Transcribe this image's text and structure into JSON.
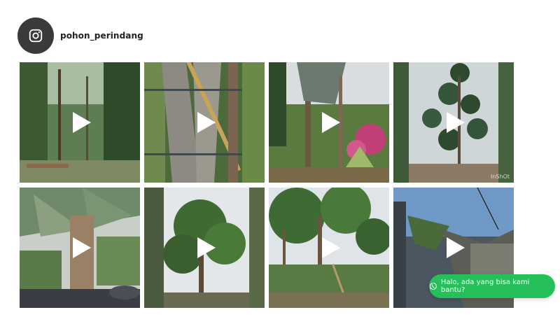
{
  "profile": {
    "username": "pohon_perindang",
    "icon": "instagram-icon"
  },
  "feed": {
    "posts": [
      {
        "type": "video",
        "icon": "play-icon",
        "watermark": ""
      },
      {
        "type": "video",
        "icon": "play-icon",
        "watermark": ""
      },
      {
        "type": "video",
        "icon": "play-icon",
        "watermark": ""
      },
      {
        "type": "video",
        "icon": "play-icon",
        "watermark": "InShOt"
      },
      {
        "type": "video",
        "icon": "play-icon",
        "watermark": ""
      },
      {
        "type": "video",
        "icon": "play-icon",
        "watermark": ""
      },
      {
        "type": "video",
        "icon": "play-icon",
        "watermark": ""
      },
      {
        "type": "video",
        "icon": "play-icon",
        "watermark": ""
      }
    ]
  },
  "chat_widget": {
    "label": "Halo, ada yang bisa kami bantu?",
    "icon": "whatsapp-icon",
    "color": "#25c05a"
  }
}
